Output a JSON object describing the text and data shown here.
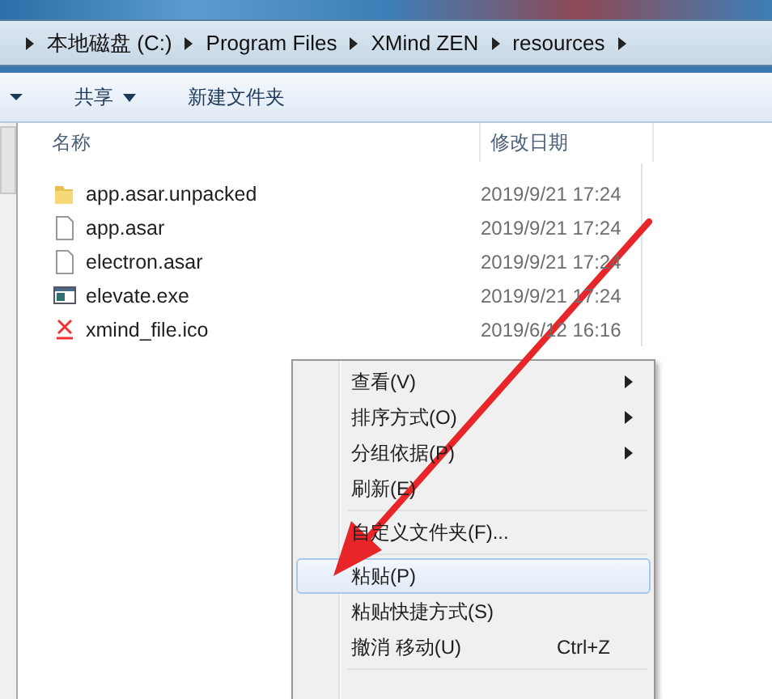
{
  "breadcrumb": [
    "本地磁盘 (C:)",
    "Program Files",
    "XMind ZEN",
    "resources"
  ],
  "toolbar": [
    {
      "label": "共享",
      "dropdown": true
    },
    {
      "label": "新建文件夹",
      "dropdown": false
    }
  ],
  "columns": [
    "名称",
    "修改日期"
  ],
  "files": [
    {
      "name": "app.asar.unpacked",
      "modified": "2019/9/21 17:24",
      "kind": "folder"
    },
    {
      "name": "app.asar",
      "modified": "2019/9/21 17:24",
      "kind": "file"
    },
    {
      "name": "electron.asar",
      "modified": "2019/9/21 17:24",
      "kind": "file"
    },
    {
      "name": "elevate.exe",
      "modified": "2019/9/21 17:24",
      "kind": "exe"
    },
    {
      "name": "xmind_file.ico",
      "modified": "2019/6/12 16:16",
      "kind": "ico"
    }
  ],
  "context_menu": [
    {
      "kind": "item",
      "label": "查看(V)",
      "submenu": true,
      "selected": false
    },
    {
      "kind": "item",
      "label": "排序方式(O)",
      "submenu": true,
      "selected": false
    },
    {
      "kind": "item",
      "label": "分组依据(P)",
      "submenu": true,
      "selected": false
    },
    {
      "kind": "item",
      "label": "刷新(E)",
      "submenu": false,
      "selected": false
    },
    {
      "kind": "separator"
    },
    {
      "kind": "item",
      "label": "自定义文件夹(F)...",
      "submenu": false,
      "selected": false
    },
    {
      "kind": "separator"
    },
    {
      "kind": "item",
      "label": "粘贴(P)",
      "submenu": false,
      "selected": true
    },
    {
      "kind": "item",
      "label": "粘贴快捷方式(S)",
      "submenu": false,
      "selected": false
    },
    {
      "kind": "item",
      "label": "撤消 移动(U)",
      "shortcut": "Ctrl+Z",
      "submenu": false,
      "selected": false
    },
    {
      "kind": "separator"
    }
  ]
}
